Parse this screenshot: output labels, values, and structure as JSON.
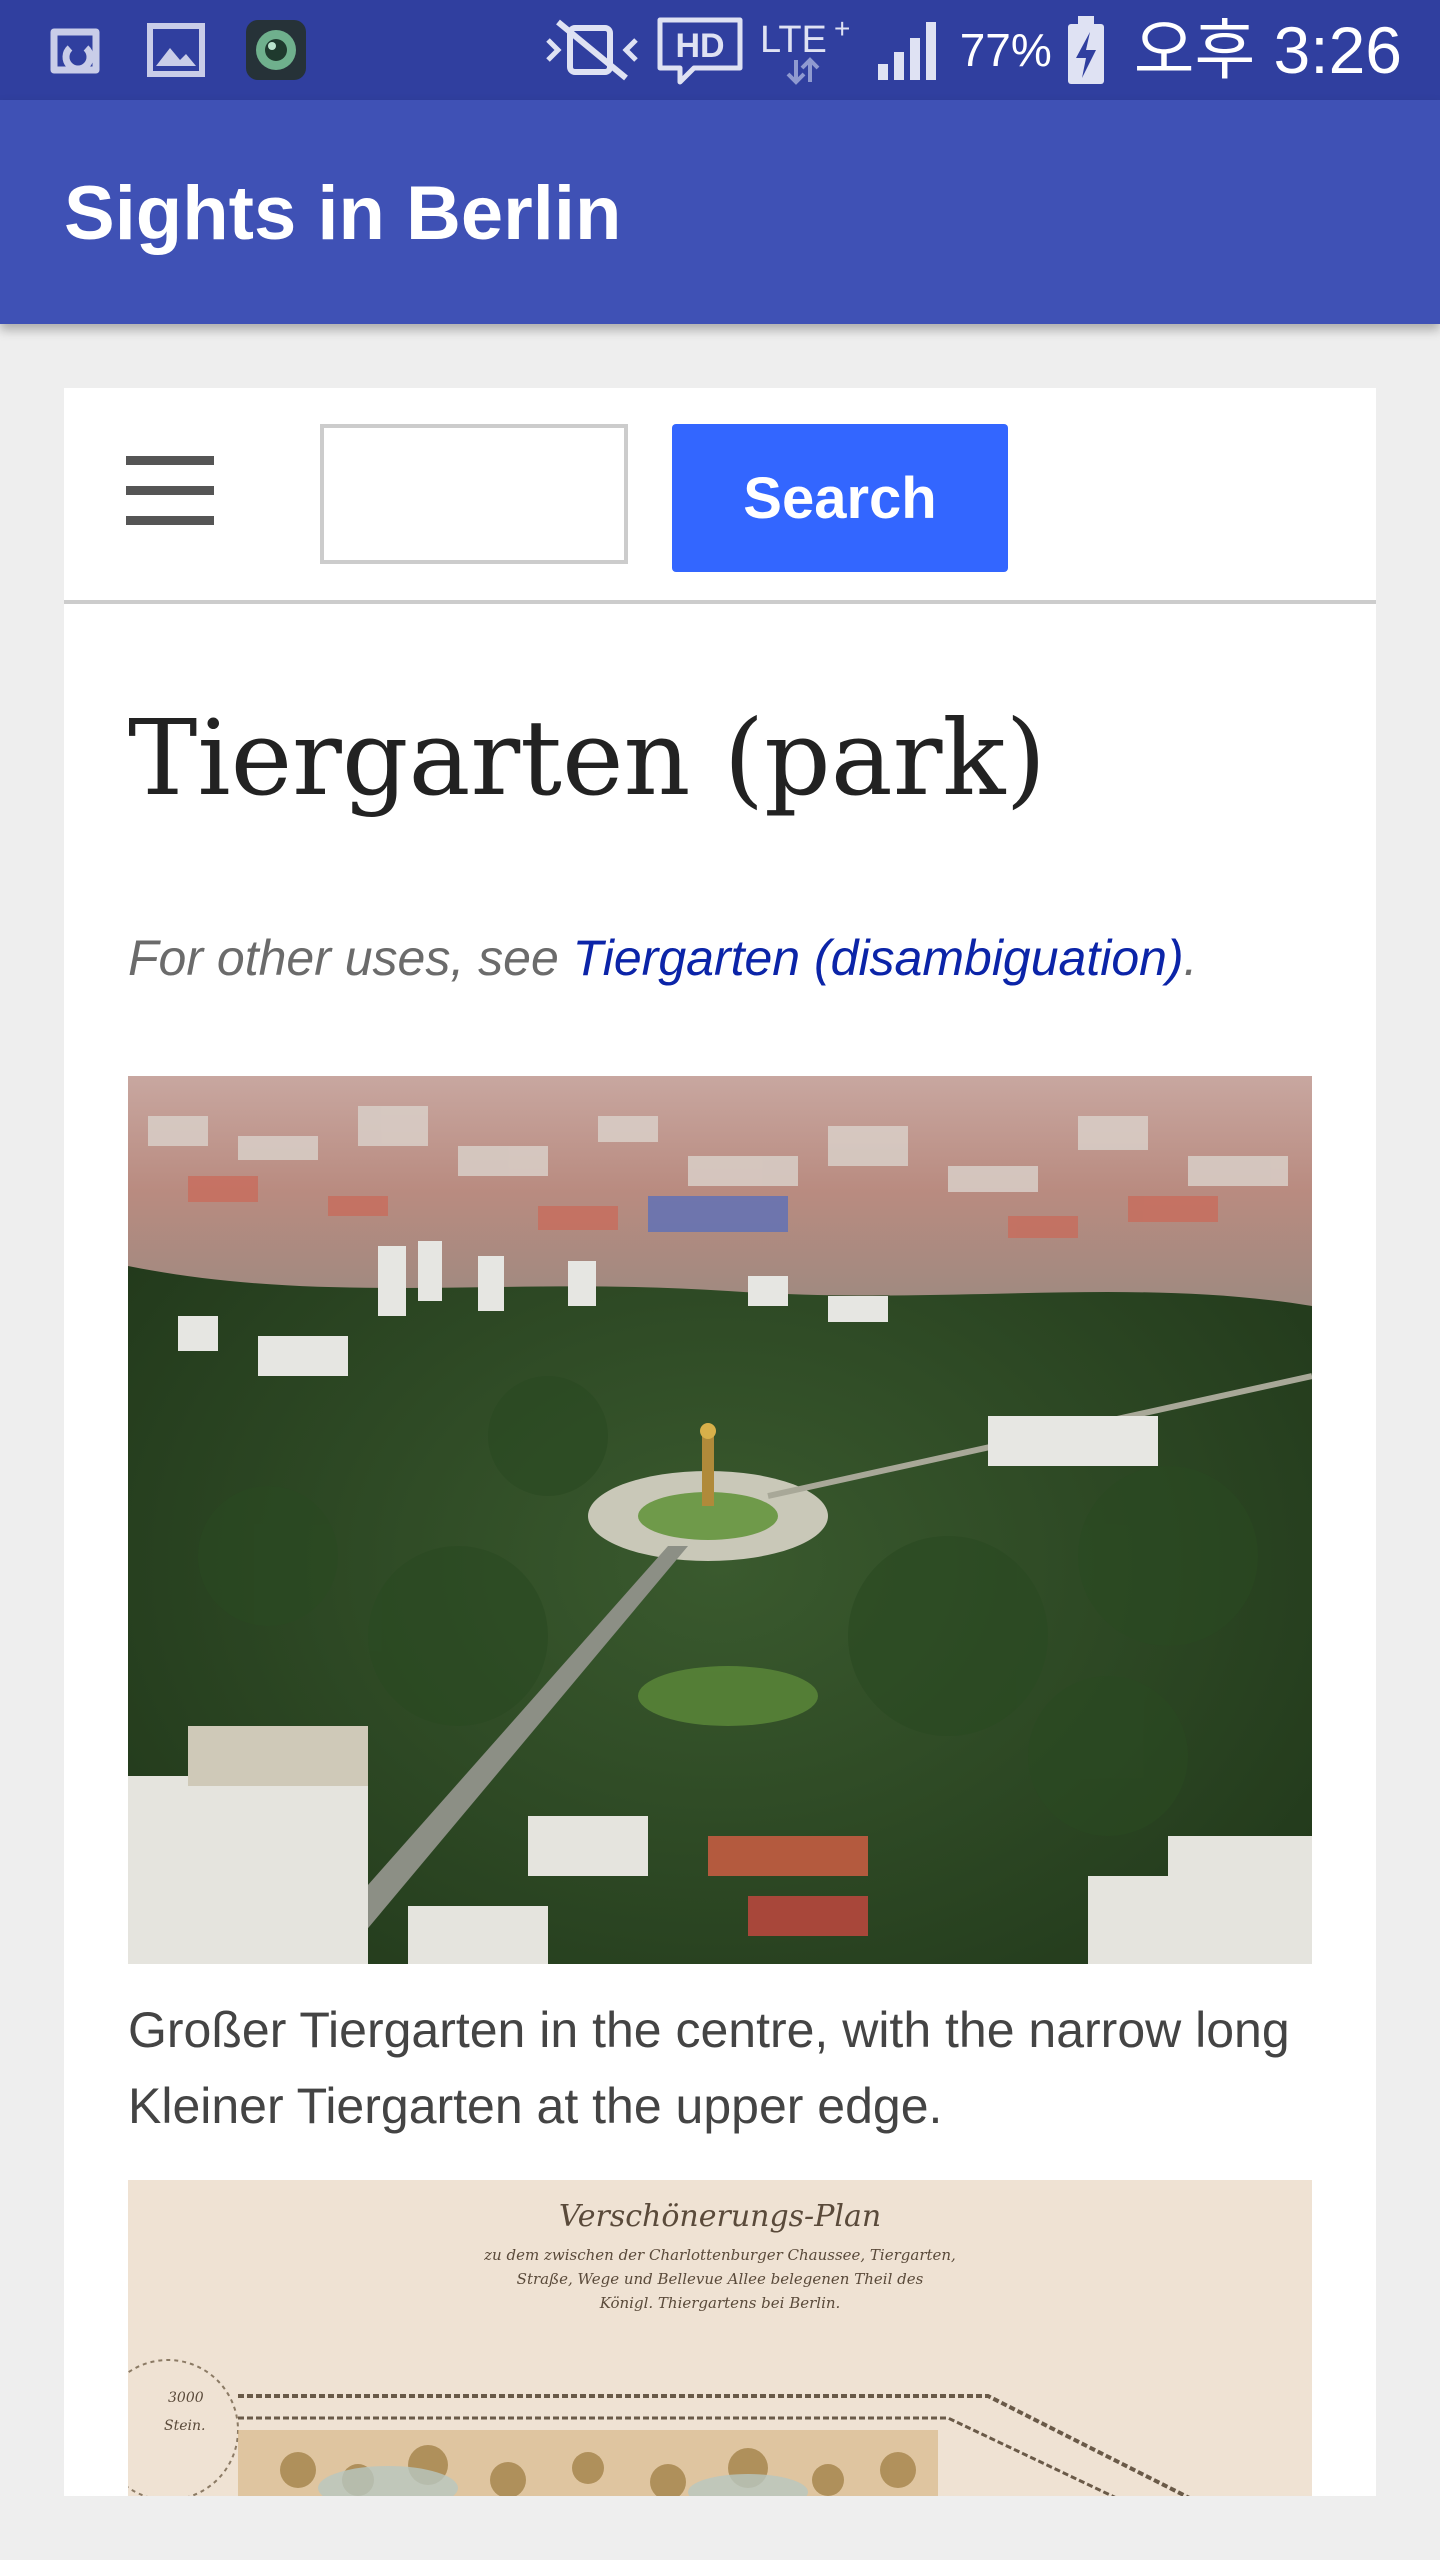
{
  "status_bar": {
    "battery": "77%",
    "clock": "오후 3:26",
    "icons": [
      "app-notification-icon",
      "gallery-icon",
      "camera-icon",
      "mute-vibrate-icon",
      "hd-voice-icon",
      "lte-plus-icon",
      "signal-icon",
      "battery-charging-icon"
    ]
  },
  "app_bar": {
    "title": "Sights in Berlin"
  },
  "search": {
    "placeholder": "",
    "value": "",
    "button_label": "Search"
  },
  "menu": {
    "icon": "hamburger-menu-icon"
  },
  "article": {
    "title": "Tiergarten (park)",
    "hatnote": {
      "prefix": "For other uses, see ",
      "link": "Tiergarten (disambiguation)",
      "suffix": "."
    },
    "figures": [
      {
        "caption": "Großer Tiergarten in the centre, with the narrow long Kleiner Tiergarten at the upper edge."
      },
      {
        "caption": "",
        "title_lines": [
          "Verschönerungs-Plan",
          "zu dem zwischen der Charlottenburger Chaussee, Tiergarten,",
          "Straße, Wege und Bellevue Allee belegenen Theil des",
          "Königl. Thiergartens bei Berlin."
        ],
        "scale_label": [
          "3000",
          "Stein."
        ]
      }
    ]
  },
  "colors": {
    "status_bar": "#303f9f",
    "app_bar": "#3f51b5",
    "search_button": "#3366ff",
    "link": "#0b24a8",
    "background": "#eeeeee"
  }
}
